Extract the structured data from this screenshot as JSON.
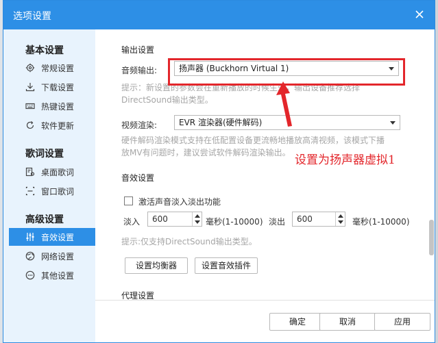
{
  "window": {
    "title": "选项设置"
  },
  "sidebar": {
    "groups": [
      {
        "title": "基本设置",
        "items": [
          {
            "label": "常规设置",
            "icon": "settings-gear-icon"
          },
          {
            "label": "下载设置",
            "icon": "download-icon"
          },
          {
            "label": "热键设置",
            "icon": "keyboard-icon"
          },
          {
            "label": "软件更新",
            "icon": "refresh-icon"
          }
        ]
      },
      {
        "title": "歌词设置",
        "items": [
          {
            "label": "桌面歌词",
            "icon": "desktop-lyrics-icon"
          },
          {
            "label": "窗口歌词",
            "icon": "window-lyrics-icon"
          }
        ]
      },
      {
        "title": "高级设置",
        "items": [
          {
            "label": "音效设置",
            "icon": "equalizer-icon",
            "active": true
          },
          {
            "label": "网络设置",
            "icon": "globe-icon"
          },
          {
            "label": "其他设置",
            "icon": "more-icon"
          }
        ]
      }
    ]
  },
  "output": {
    "section_title": "输出设置",
    "audio_label": "音频输出:",
    "audio_value": "扬声器 (Buckhorn Virtual 1)",
    "audio_hint": "提示：新设置的参数会在重新播放的时候生效，输出设备推荐选择DirectSound输出类型。",
    "video_label": "视频渲染:",
    "video_value": "EVR 渲染器(硬件解码)",
    "video_hint": "硬件解码渲染模式支持在低配置设备更流畅地播放高清视频，该模式下播放MV有问题时，建议尝试软件解码渲染输出。"
  },
  "effects": {
    "section_title": "音效设置",
    "fade_checkbox_label": "激活声音淡入淡出功能",
    "fade_checked": false,
    "fade_in_label": "淡入",
    "fade_in_value": "600",
    "fade_in_unit": "毫秒(1-10000)",
    "fade_out_label": "淡出",
    "fade_out_value": "600",
    "fade_out_unit": "毫秒(1-10000)",
    "hint": "提示:仅支持DirectSound输出类型。",
    "equalizer_button": "设置均衡器",
    "plugin_button": "设置音效插件"
  },
  "proxy": {
    "section_title": "代理设置"
  },
  "footer": {
    "ok": "确定",
    "cancel": "取消",
    "apply": "应用"
  },
  "annotation": {
    "text": "设置为扬声器虚拟1",
    "color": "#e3262b"
  },
  "colors": {
    "accent": "#2d8fe6",
    "sidebar_bg": "#e8f3fd",
    "hint_text": "#a6a6a6"
  }
}
